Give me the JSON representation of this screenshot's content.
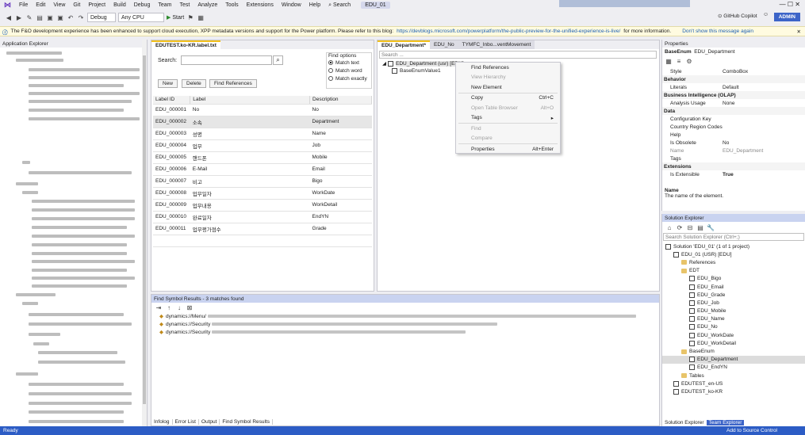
{
  "titlebar": {
    "menu": [
      "File",
      "Edit",
      "View",
      "Git",
      "Project",
      "Build",
      "Debug",
      "Team",
      "Test",
      "Analyze",
      "Tools",
      "Extensions",
      "Window",
      "Help"
    ],
    "search": "Search",
    "project_name": "EDU_01"
  },
  "toolbar": {
    "config": "Debug",
    "platform": "Any CPU",
    "start": "Start",
    "copilot": "GitHub Copilot",
    "user": "ADMIN"
  },
  "infobar": {
    "text": "The F&O development experience has been enhanced to support cloud execution, XPP metadata versions and support for the Power platform. Please refer to this blog:",
    "link": "https://devblogs.microsoft.com/powerplatform/the-public-preview-for-the-unified-experience-is-live/",
    "suffix": "for more information.",
    "dismiss": "Don't show this message again"
  },
  "app_explorer": {
    "title": "Application Explorer"
  },
  "label_editor": {
    "tab": "EDUTEST.ko-KR.label.txt",
    "search_label": "Search:",
    "search_value": "",
    "find_options_title": "Find options",
    "options": [
      "Match text",
      "Match word",
      "Match exactly"
    ],
    "selected_option": 0,
    "buttons": {
      "new": "New",
      "delete": "Delete",
      "find_refs": "Find References"
    },
    "columns": [
      "Label ID",
      "Label",
      "Description"
    ],
    "rows": [
      [
        "EDU_000001",
        "No",
        "No"
      ],
      [
        "EDU_000002",
        "소속",
        "Department"
      ],
      [
        "EDU_000003",
        "성명",
        "Name"
      ],
      [
        "EDU_000004",
        "업무",
        "Job"
      ],
      [
        "EDU_000005",
        "핸드폰",
        "Mobile"
      ],
      [
        "EDU_000006",
        "E-Mail",
        "Email"
      ],
      [
        "EDU_000007",
        "비고",
        "Bigo"
      ],
      [
        "EDU_000008",
        "업무일자",
        "WorkDate"
      ],
      [
        "EDU_000009",
        "업무내용",
        "WorkDetail"
      ],
      [
        "EDU_000010",
        "완료일자",
        "EndYN"
      ],
      [
        "EDU_000011",
        "업무평가점수",
        "Grade"
      ]
    ],
    "selected_row": 1
  },
  "designer": {
    "tabs": [
      "EDU_Department*",
      "EDU_No",
      "TYMFC_Inbo...ventMovement"
    ],
    "search_placeholder": "Search ...",
    "root_node": "EDU_Department (usr) [EDU]",
    "child_node": "BaseEnumValue1"
  },
  "context_menu": {
    "items": [
      {
        "label": "Find References",
        "shortcut": "",
        "disabled": false
      },
      {
        "label": "View Hierarchy",
        "shortcut": "",
        "disabled": true
      },
      {
        "label": "New Element",
        "shortcut": "",
        "disabled": false
      },
      {
        "label": "Copy",
        "shortcut": "Ctrl+C",
        "disabled": false
      },
      {
        "label": "Open Table Browser",
        "shortcut": "Alt+O",
        "disabled": true
      },
      {
        "label": "Tags",
        "shortcut": "▸",
        "disabled": false
      },
      {
        "label": "Find",
        "shortcut": "",
        "disabled": true
      },
      {
        "label": "Compare",
        "shortcut": "",
        "disabled": true
      },
      {
        "label": "Properties",
        "shortcut": "Alt+Enter",
        "disabled": false
      }
    ]
  },
  "properties": {
    "title": "Properties",
    "object_type": "BaseEnum",
    "object_name": "EDU_Department",
    "rows": [
      {
        "type": "row",
        "k": "Style",
        "v": "ComboBox"
      },
      {
        "type": "cat",
        "k": "Behavior"
      },
      {
        "type": "row",
        "k": "Literals",
        "v": "Default"
      },
      {
        "type": "cat",
        "k": "Business Intelligence (OLAP)"
      },
      {
        "type": "row",
        "k": "Analysis Usage",
        "v": "None"
      },
      {
        "type": "cat",
        "k": "Data"
      },
      {
        "type": "row",
        "k": "Configuration Key",
        "v": ""
      },
      {
        "type": "row",
        "k": "Country Region Codes",
        "v": ""
      },
      {
        "type": "row",
        "k": "Help",
        "v": ""
      },
      {
        "type": "row",
        "k": "Is Obsolete",
        "v": "No"
      },
      {
        "type": "row",
        "k": "Name",
        "v": "EDU_Department"
      },
      {
        "type": "row",
        "k": "Tags",
        "v": ""
      },
      {
        "type": "cat",
        "k": "Extensions"
      },
      {
        "type": "row",
        "k": "Is Extensible",
        "v": "True"
      }
    ],
    "desc_title": "Name",
    "desc_text": "The name of the element."
  },
  "solution_explorer": {
    "title": "Solution Explorer",
    "search_placeholder": "Search Solution Explorer (Ctrl+;)",
    "items": [
      {
        "label": "Solution 'EDU_01' (1 of 1 project)",
        "indent": 0,
        "icon": "solution"
      },
      {
        "label": "EDU_01 (USR) [EDU]",
        "indent": 1,
        "icon": "project"
      },
      {
        "label": "References",
        "indent": 2,
        "icon": "folder"
      },
      {
        "label": "EDT",
        "indent": 2,
        "icon": "folder"
      },
      {
        "label": "EDU_Bigo",
        "indent": 3,
        "icon": "element"
      },
      {
        "label": "EDU_Email",
        "indent": 3,
        "icon": "element"
      },
      {
        "label": "EDU_Grade",
        "indent": 3,
        "icon": "element"
      },
      {
        "label": "EDU_Job",
        "indent": 3,
        "icon": "element"
      },
      {
        "label": "EDU_Mobile",
        "indent": 3,
        "icon": "element"
      },
      {
        "label": "EDU_Name",
        "indent": 3,
        "icon": "element"
      },
      {
        "label": "EDU_No",
        "indent": 3,
        "icon": "element"
      },
      {
        "label": "EDU_WorkDate",
        "indent": 3,
        "icon": "element"
      },
      {
        "label": "EDU_WorkDetail",
        "indent": 3,
        "icon": "element"
      },
      {
        "label": "BaseEnum",
        "indent": 2,
        "icon": "folder"
      },
      {
        "label": "EDU_Department",
        "indent": 3,
        "icon": "element",
        "selected": true
      },
      {
        "label": "EDU_EndYN",
        "indent": 3,
        "icon": "element"
      },
      {
        "label": "Tables",
        "indent": 2,
        "icon": "folder"
      },
      {
        "label": "EDUTEST_en-US",
        "indent": 1,
        "icon": "element"
      },
      {
        "label": "EDUTEST_ko-KR",
        "indent": 1,
        "icon": "element"
      }
    ],
    "bottom_tabs": [
      "Solution Explorer",
      "Team Explorer"
    ]
  },
  "find_symbol": {
    "title": "Find Symbol Results - 3 matches found",
    "results": [
      "dynamics://Menu/",
      "dynamics://Security",
      "dynamics://Security"
    ],
    "bottom_tabs": [
      "Infolog",
      "Error List",
      "Output",
      "Find Symbol Results"
    ]
  },
  "status": {
    "left": "Ready",
    "right": "Add to Source Control"
  },
  "colors": {
    "accent": "#2c5cc5",
    "tab_gold": "#f2c01a",
    "admin": "#3c64c8"
  }
}
